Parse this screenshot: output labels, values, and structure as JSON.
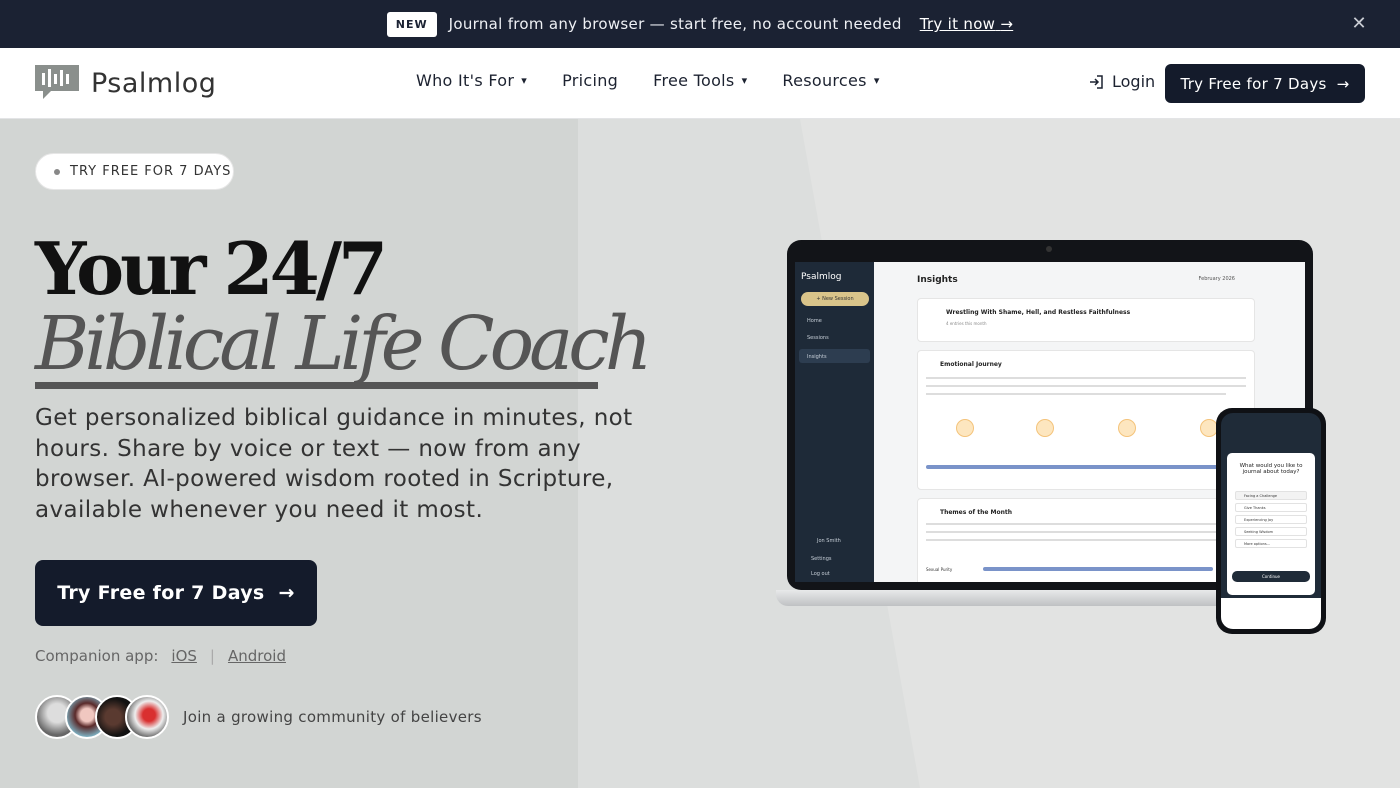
{
  "announcement": {
    "badge": "NEW",
    "message": "Journal from any browser — start free, no account needed",
    "cta": "Try it now",
    "cta_icon": "arrow-right-icon",
    "close_icon": "close-icon"
  },
  "header": {
    "logo_text": "Psalmlog",
    "nav": [
      {
        "label": "Who It's For",
        "dropdown": true
      },
      {
        "label": "Pricing",
        "dropdown": false
      },
      {
        "label": "Free Tools",
        "dropdown": true
      },
      {
        "label": "Resources",
        "dropdown": true
      }
    ],
    "login": "Login",
    "cta": "Try Free for 7 Days"
  },
  "hero": {
    "pill": "TRY FREE FOR 7 DAYS",
    "headline_1": "Your 24/7",
    "headline_2": "Biblical Life Coach",
    "description": "Get personalized biblical guidance in minutes, not hours. Share by voice or text — now from any browser. AI-powered wisdom rooted in Scripture, available whenever you need it most.",
    "cta": "Try Free for 7 Days",
    "companion_label": "Companion app:",
    "ios": "iOS",
    "android": "Android",
    "community": "Join a growing community of believers"
  },
  "mockup": {
    "app_name": "Psalmlog",
    "new_session": "+ New Session",
    "nav": [
      "Home",
      "Sessions",
      "Insights"
    ],
    "user": "Jon Smith",
    "settings": "Settings",
    "logout": "Log out",
    "page_title": "Insights",
    "date": "February 2026",
    "card1_title": "Wrestling With Shame, Hell, and Restless Faithfulness",
    "card1_sub": "4 entries this month",
    "card2_title": "Emotional Journey",
    "card3_title": "Themes of the Month",
    "card3_sub": "Sexual Purity",
    "phone_question": "What would you like to journal about today?",
    "phone_options": [
      "Facing a Challenge",
      "Give Thanks",
      "Experiencing Joy",
      "Seeking Wisdom",
      "More options..."
    ],
    "phone_continue": "Continue"
  },
  "colors": {
    "navy": "#141b2b",
    "announce_bg": "#1b2233",
    "hero_bg": "#d2d5d3"
  }
}
